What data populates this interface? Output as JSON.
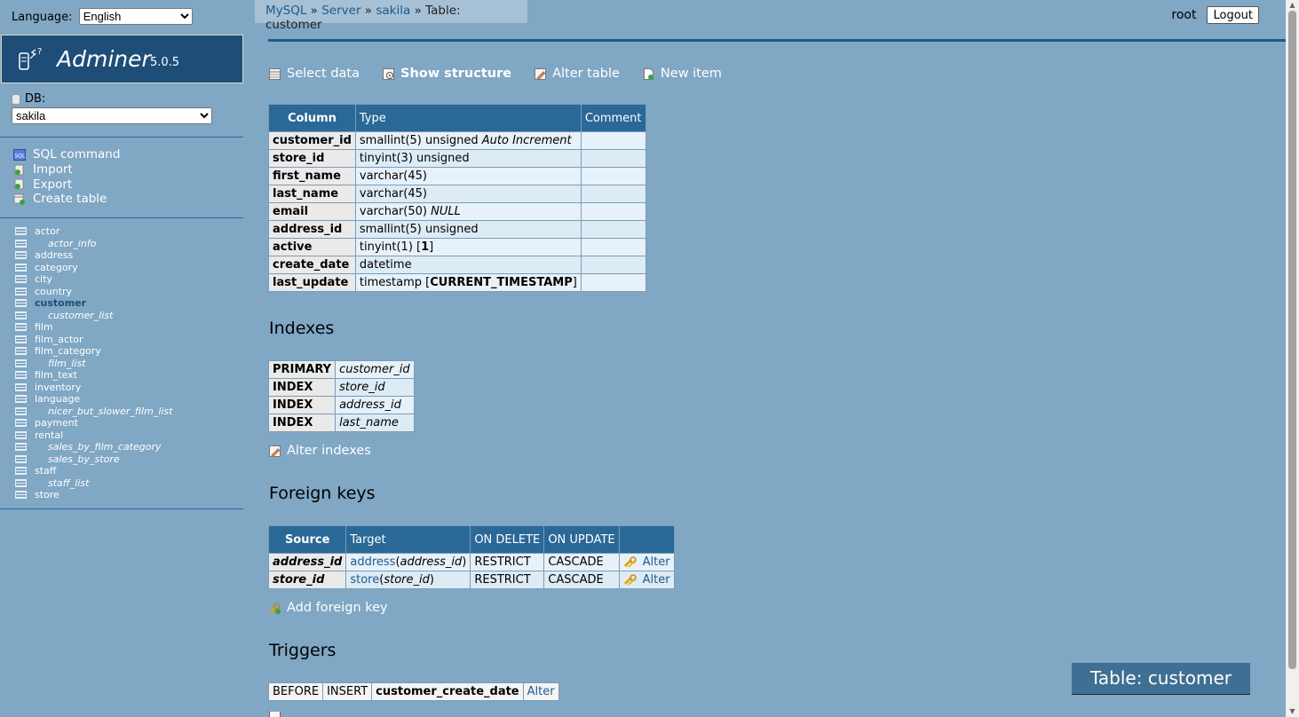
{
  "language": {
    "label": "Language:",
    "selected": "English"
  },
  "logo": {
    "title": "Adminer",
    "version": "5.0.5"
  },
  "db": {
    "label": "DB:",
    "selected": "sakila"
  },
  "commands": [
    "SQL command",
    "Import",
    "Export",
    "Create table"
  ],
  "tables": [
    {
      "name": "actor",
      "view": false
    },
    {
      "name": "actor_info",
      "view": true
    },
    {
      "name": "address",
      "view": false
    },
    {
      "name": "category",
      "view": false
    },
    {
      "name": "city",
      "view": false
    },
    {
      "name": "country",
      "view": false
    },
    {
      "name": "customer",
      "view": false,
      "active": true
    },
    {
      "name": "customer_list",
      "view": true
    },
    {
      "name": "film",
      "view": false
    },
    {
      "name": "film_actor",
      "view": false
    },
    {
      "name": "film_category",
      "view": false
    },
    {
      "name": "film_list",
      "view": true
    },
    {
      "name": "film_text",
      "view": false
    },
    {
      "name": "inventory",
      "view": false
    },
    {
      "name": "language",
      "view": false
    },
    {
      "name": "nicer_but_slower_film_list",
      "view": true
    },
    {
      "name": "payment",
      "view": false
    },
    {
      "name": "rental",
      "view": false
    },
    {
      "name": "sales_by_film_category",
      "view": true
    },
    {
      "name": "sales_by_store",
      "view": true
    },
    {
      "name": "staff",
      "view": false
    },
    {
      "name": "staff_list",
      "view": true
    },
    {
      "name": "store",
      "view": false
    }
  ],
  "breadcrumb": {
    "mysql": "MySQL",
    "sep": "»",
    "server": "Server",
    "db": "sakila",
    "current": "Table: customer"
  },
  "user": {
    "name": "root",
    "logout": "Logout"
  },
  "nav": {
    "select": "Select data",
    "structure": "Show structure",
    "alter": "Alter table",
    "new": "New item"
  },
  "columns": {
    "headers": [
      "Column",
      "Type",
      "Comment"
    ],
    "rows": [
      {
        "name": "customer_id",
        "type": "smallint(5) unsigned",
        "extra": "Auto Increment",
        "extra_style": "italic",
        "comment": ""
      },
      {
        "name": "store_id",
        "type": "tinyint(3) unsigned",
        "extra": "",
        "comment": ""
      },
      {
        "name": "first_name",
        "type": "varchar(45)",
        "extra": "",
        "comment": ""
      },
      {
        "name": "last_name",
        "type": "varchar(45)",
        "extra": "",
        "comment": ""
      },
      {
        "name": "email",
        "type": "varchar(50)",
        "extra": "NULL",
        "extra_style": "italic",
        "comment": ""
      },
      {
        "name": "address_id",
        "type": "smallint(5) unsigned",
        "extra": "",
        "comment": ""
      },
      {
        "name": "active",
        "type": "tinyint(1)",
        "default": "1",
        "comment": ""
      },
      {
        "name": "create_date",
        "type": "datetime",
        "extra": "",
        "comment": ""
      },
      {
        "name": "last_update",
        "type": "timestamp",
        "default": "CURRENT_TIMESTAMP",
        "comment": ""
      }
    ]
  },
  "indexes": {
    "title": "Indexes",
    "rows": [
      {
        "type": "PRIMARY",
        "column": "customer_id"
      },
      {
        "type": "INDEX",
        "column": "store_id"
      },
      {
        "type": "INDEX",
        "column": "address_id"
      },
      {
        "type": "INDEX",
        "column": "last_name"
      }
    ],
    "alter": "Alter indexes"
  },
  "foreign_keys": {
    "title": "Foreign keys",
    "headers": [
      "Source",
      "Target",
      "ON DELETE",
      "ON UPDATE",
      ""
    ],
    "rows": [
      {
        "source": "address_id",
        "target_table": "address",
        "target_col": "address_id",
        "on_delete": "RESTRICT",
        "on_update": "CASCADE",
        "alter": "Alter"
      },
      {
        "source": "store_id",
        "target_table": "store",
        "target_col": "store_id",
        "on_delete": "RESTRICT",
        "on_update": "CASCADE",
        "alter": "Alter"
      }
    ],
    "add": "Add foreign key"
  },
  "triggers": {
    "title": "Triggers",
    "rows": [
      {
        "timing": "BEFORE",
        "event": "INSERT",
        "name": "customer_create_date",
        "alter": "Alter"
      }
    ]
  },
  "floating_title": "Table: customer"
}
